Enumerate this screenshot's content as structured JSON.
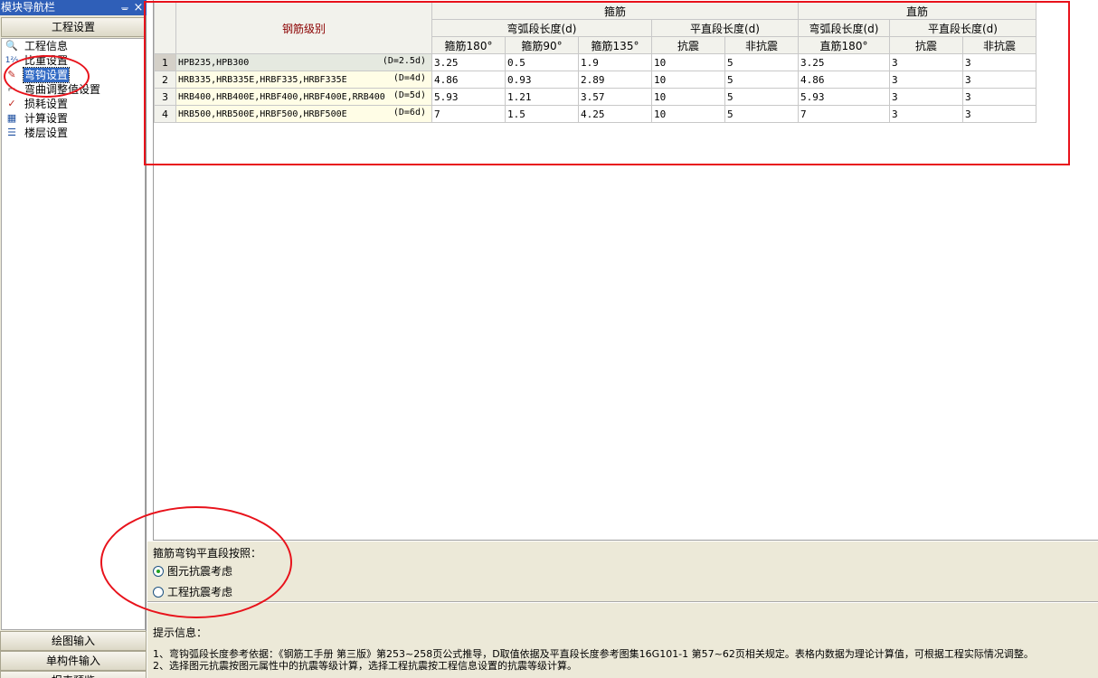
{
  "nav": {
    "title": "模块导航栏",
    "pin_glyph": "ᚚ",
    "close_glyph": "×",
    "section_button": "工程设置",
    "items": [
      {
        "label": "工程信息",
        "icon": "magnifier-doc-icon",
        "glyph": "🔍"
      },
      {
        "label": "比重设置",
        "icon": "weight-ruler-icon",
        "glyph": "1⅔"
      },
      {
        "label": "弯钩设置",
        "icon": "hook-pencil-icon",
        "glyph": "✎"
      },
      {
        "label": "弯曲调整值设置",
        "icon": "bend-adjust-icon",
        "glyph": "⌐"
      },
      {
        "label": "损耗设置",
        "icon": "loss-check-icon",
        "glyph": "✓"
      },
      {
        "label": "计算设置",
        "icon": "calc-settings-icon",
        "glyph": "▦"
      },
      {
        "label": "楼层设置",
        "icon": "floors-stack-icon",
        "glyph": "☰"
      }
    ],
    "selected_index": 2,
    "bottom_buttons": [
      "绘图输入",
      "单构件输入",
      "报表预览"
    ]
  },
  "table": {
    "grade_header": "钢筋级别",
    "group_stirrup": "箍筋",
    "group_straight": "直筋",
    "sub_arc": "弯弧段长度(d)",
    "sub_flat": "平直段长度(d)",
    "cols": [
      "箍筋180°",
      "箍筋90°",
      "箍筋135°",
      "抗震",
      "非抗震",
      "直筋180°",
      "抗震",
      "非抗震"
    ],
    "rows": [
      {
        "num": "1",
        "grade": "HPB235,HPB300",
        "d": "(D=2.5d)",
        "vals": [
          "3.25",
          "0.5",
          "1.9",
          "10",
          "5",
          "3.25",
          "3",
          "3"
        ]
      },
      {
        "num": "2",
        "grade": "HRB335,HRB335E,HRBF335,HRBF335E",
        "d": "(D=4d)",
        "vals": [
          "4.86",
          "0.93",
          "2.89",
          "10",
          "5",
          "4.86",
          "3",
          "3"
        ]
      },
      {
        "num": "3",
        "grade": "HRB400,HRB400E,HRBF400,HRBF400E,RRB400",
        "d": "(D=5d)",
        "vals": [
          "5.93",
          "1.21",
          "3.57",
          "10",
          "5",
          "5.93",
          "3",
          "3"
        ]
      },
      {
        "num": "4",
        "grade": "HRB500,HRB500E,HRBF500,HRBF500E",
        "d": "(D=6d)",
        "vals": [
          "7",
          "1.5",
          "4.25",
          "10",
          "5",
          "7",
          "3",
          "3"
        ]
      }
    ]
  },
  "options": {
    "label": "箍筋弯钩平直段按照：",
    "radio_1": "图元抗震考虑",
    "radio_2": "工程抗震考虑",
    "selected": 1
  },
  "tips": {
    "title": "提示信息：",
    "line_1": "1、弯钩弧段长度参考依据：《钢筋工手册 第三版》第253~258页公式推导，D取值依据及平直段长度参考图集16G101-1 第57~62页相关规定。表格内数据为理论计算值，可根据工程实际情况调整。",
    "line_2": "2、选择图元抗震按图元属性中的抗震等级计算，选择工程抗震按工程信息设置的抗震等级计算。"
  },
  "colors": {
    "annotation_red": "#e8121b",
    "title_bar_blue": "#2f5fb8",
    "grade_header_orange": "#f3b65b",
    "grade_text_darkred": "#8b0000",
    "radio_dot_green": "#21a121"
  }
}
